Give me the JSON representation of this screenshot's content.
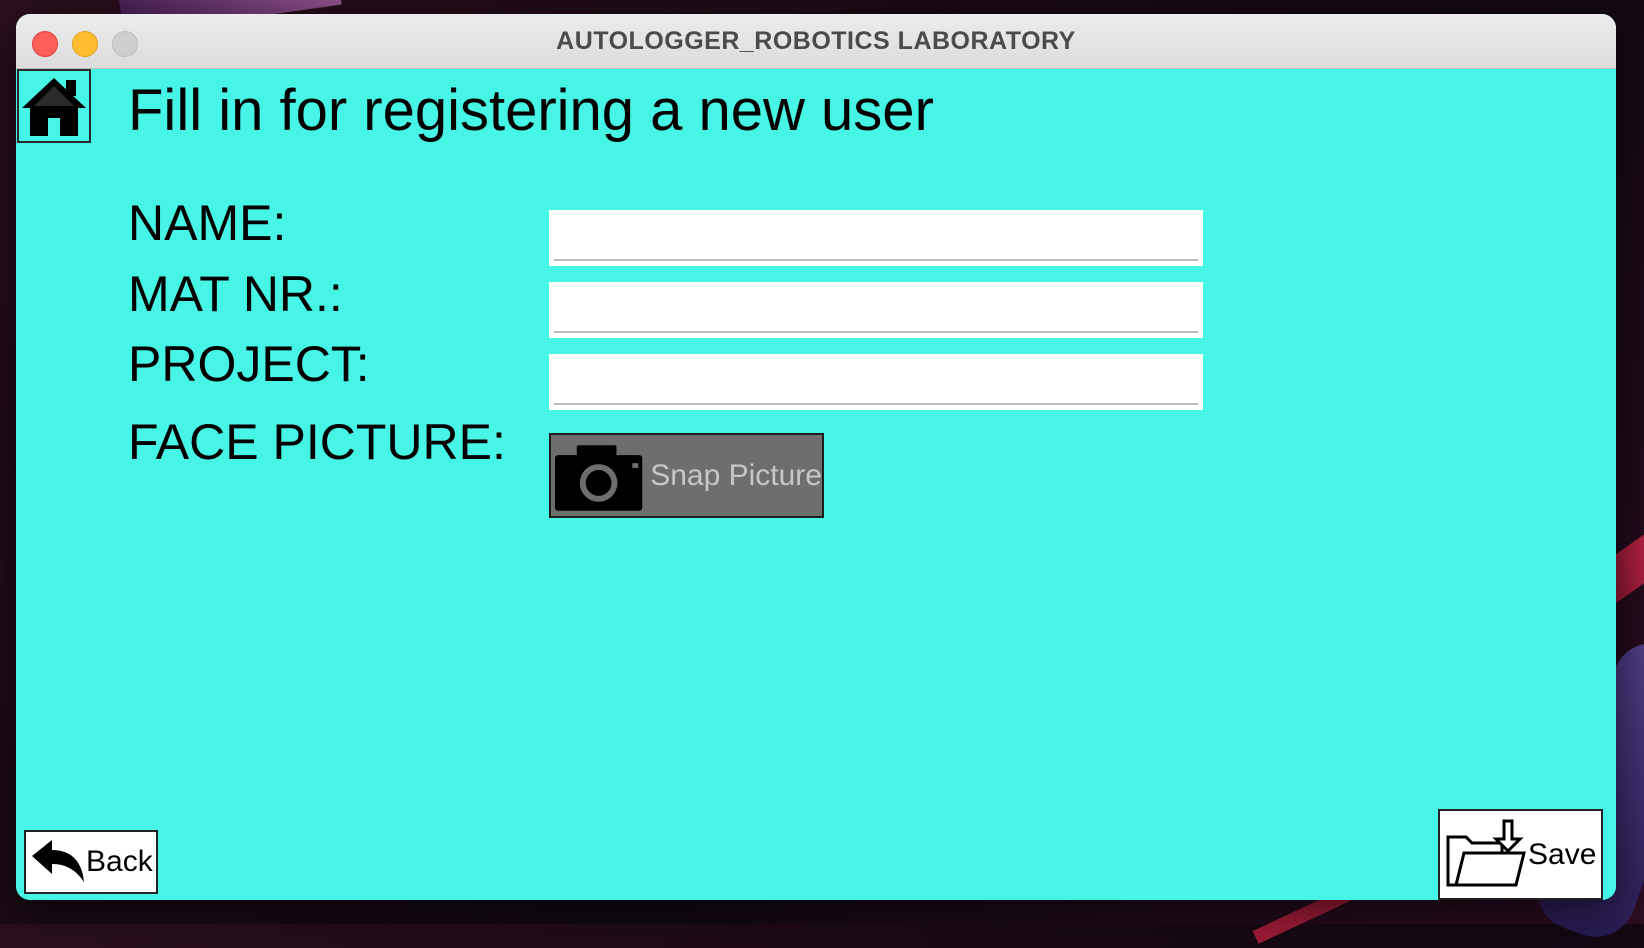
{
  "window": {
    "title": "AUTOLOGGER_ROBOTICS LABORATORY"
  },
  "page": {
    "heading": "Fill in for registering a new user"
  },
  "form": {
    "name_label": "NAME:",
    "name_value": "",
    "matnr_label": "MAT NR.:",
    "matnr_value": "",
    "project_label": "PROJECT:",
    "project_value": "",
    "face_label": "FACE PICTURE:",
    "snap_label": "Snap Picture"
  },
  "actions": {
    "back_label": "Back",
    "save_label": "Save"
  },
  "icons": {
    "home": "home-icon",
    "camera": "camera-icon",
    "back": "back-arrow-icon",
    "save": "folder-save-icon"
  },
  "colors": {
    "background": "#46f5e6",
    "snap_button": "#6e6e6e"
  }
}
